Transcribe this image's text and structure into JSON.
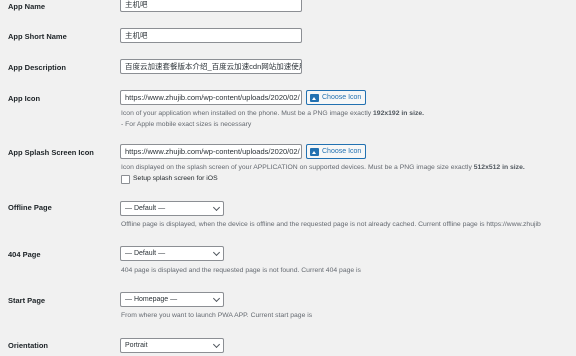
{
  "fields": {
    "app_name": {
      "label": "App Name",
      "value": "主机吧"
    },
    "app_short_name": {
      "label": "App Short Name",
      "value": "主机吧"
    },
    "app_description": {
      "label": "App Description",
      "value": "百度云加速套餐版本介绍_百度云加速cdn网站加速使用"
    },
    "app_icon": {
      "label": "App Icon",
      "value": "https://www.zhujib.com/wp-content/uploads/2020/02/",
      "button": "Choose Icon",
      "desc_prefix": "Icon of your application when installed on the phone. Must be a PNG image exactly ",
      "desc_size": "192x192 in size.",
      "desc_note": "- For Apple mobile exact sizes is necessary"
    },
    "app_splash": {
      "label": "App Splash Screen Icon",
      "value": "https://www.zhujib.com/wp-content/uploads/2020/02/",
      "button": "Choose Icon",
      "desc_prefix": "Icon displayed on the splash screen of your APPLICATION on supported devices. Must be a PNG image size exactly ",
      "desc_size": "512x512 in size.",
      "checkbox_label": "Setup splash screen for iOS"
    },
    "offline_page": {
      "label": "Offline Page",
      "selected": "— Default —",
      "desc": "Offline page is displayed, when the device is offline and the requested page is not already cached. Current offline page is https://www.zhujib"
    },
    "page_404": {
      "label": "404 Page",
      "selected": "— Default —",
      "desc": "404 page is displayed and the requested page is not found. Current 404 page is"
    },
    "start_page": {
      "label": "Start Page",
      "selected": "— Homepage —",
      "desc": "From where you want to launch PWA APP. Current start page is"
    },
    "orientation": {
      "label": "Orientation",
      "selected": "Portrait"
    }
  }
}
